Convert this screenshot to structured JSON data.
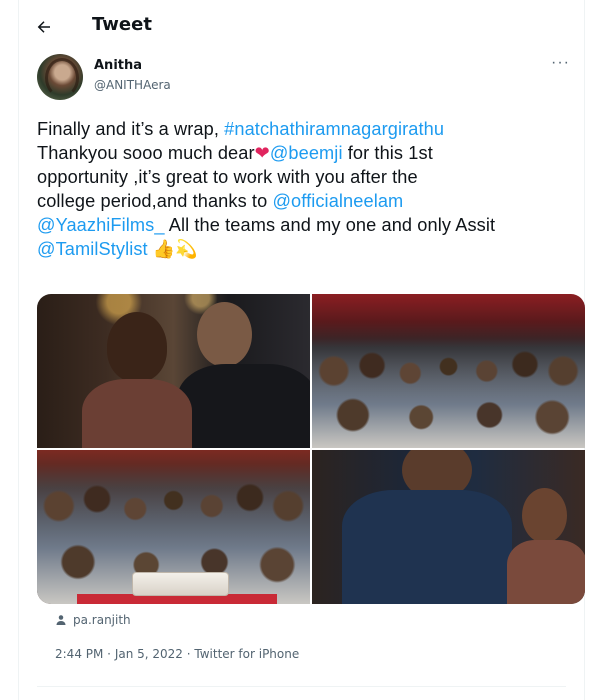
{
  "header": {
    "title": "Tweet"
  },
  "author": {
    "display_name": "Anitha",
    "handle": "@ANITHAera",
    "more": "···"
  },
  "tweet": {
    "line1_text": "Finally and it’s a wrap, ",
    "hashtag": "#natchathiramnagargirathu",
    "line2_text": "Thankyou sooo much dear",
    "mention_beemji": "@beemji",
    "line2_tail": " for this 1st",
    "line3": "opportunity ,it’s great to work with you after the",
    "line4_text": "college period,and thanks to ",
    "mention_neelam": "@officialneelam",
    "mention_yaazhi": "@YaazhiFilms_",
    "line5_tail": " All the teams and my one and only Assit",
    "mention_stylist": "@TamilStylist",
    "emoji_heart": "❤",
    "emoji_thumbs": "👍",
    "emoji_sparkle": "💫"
  },
  "media": {
    "tagged_user": "pa.ranjith"
  },
  "meta": {
    "time": "2:44 PM",
    "date": "Jan 5, 2022",
    "source": "Twitter for iPhone",
    "sep1": " · ",
    "sep2": " · "
  },
  "colors": {
    "link": "#1d9bf0",
    "text": "#0f1419",
    "secondary": "#536471",
    "heart": "#e0245e"
  }
}
